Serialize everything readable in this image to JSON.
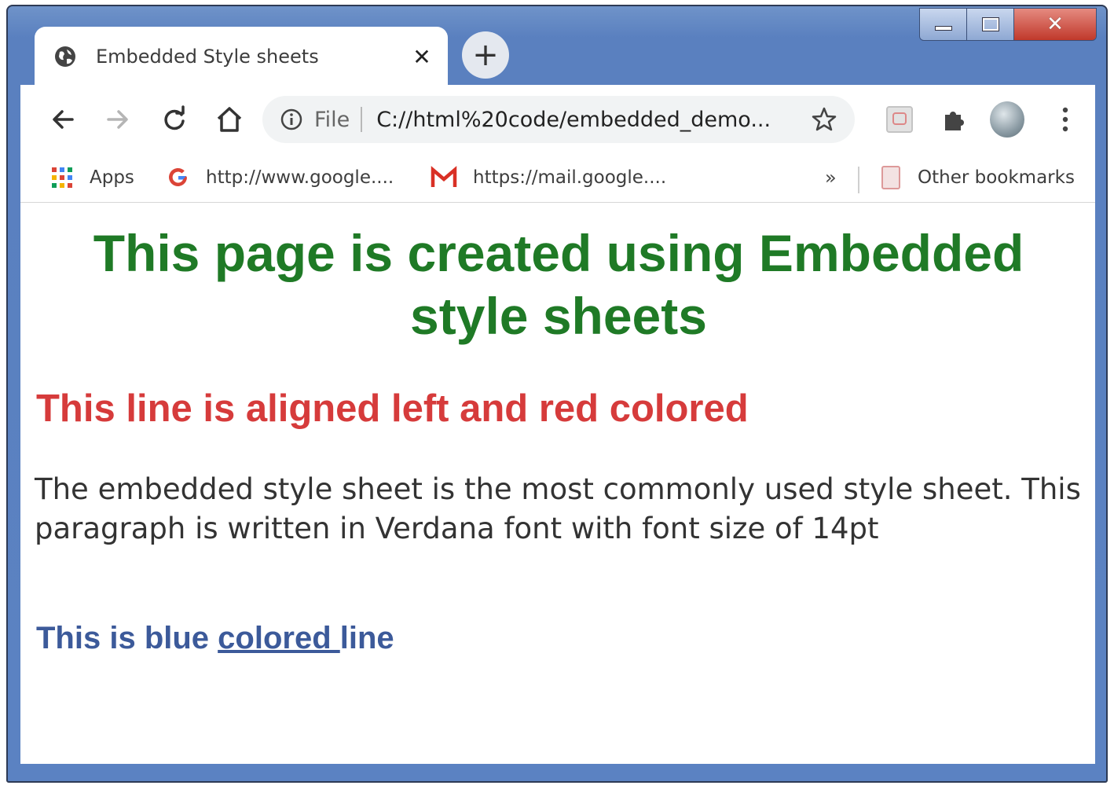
{
  "tab": {
    "title": "Embedded Style sheets",
    "close_icon": "close-icon",
    "favicon": "globe-icon"
  },
  "toolbar": {
    "back_icon": "back-arrow-icon",
    "forward_icon": "forward-arrow-icon",
    "reload_icon": "reload-icon",
    "home_icon": "home-icon",
    "omnibox": {
      "scheme_label": "File",
      "url": "C://html%20code/embedded_demo..."
    },
    "star_icon": "star-icon",
    "extension_icon": "extension-icon",
    "puzzle_icon": "puzzle-icon",
    "menu_icon": "kebab-menu-icon"
  },
  "bookmarks": {
    "apps_label": "Apps",
    "items": [
      {
        "label": "http://www.google....",
        "icon": "google-icon"
      },
      {
        "label": "https://mail.google....",
        "icon": "gmail-icon"
      }
    ],
    "overflow": "»",
    "other_label": "Other bookmarks"
  },
  "page": {
    "heading": "This page is created using Embedded style sheets",
    "red_line": "This line is aligned left and red colored",
    "paragraph": "The embedded style sheet is the most commonly used style sheet. This paragraph is written in Verdana font with font size of 14pt",
    "blue_line_prefix": "This is blue ",
    "blue_line_link": "colored ",
    "blue_line_suffix": "line"
  },
  "colors": {
    "heading_green": "#1f7a26",
    "red_text": "#d63b3b",
    "blue_text": "#3c5a9a",
    "window_frame": "#5a80bf"
  }
}
